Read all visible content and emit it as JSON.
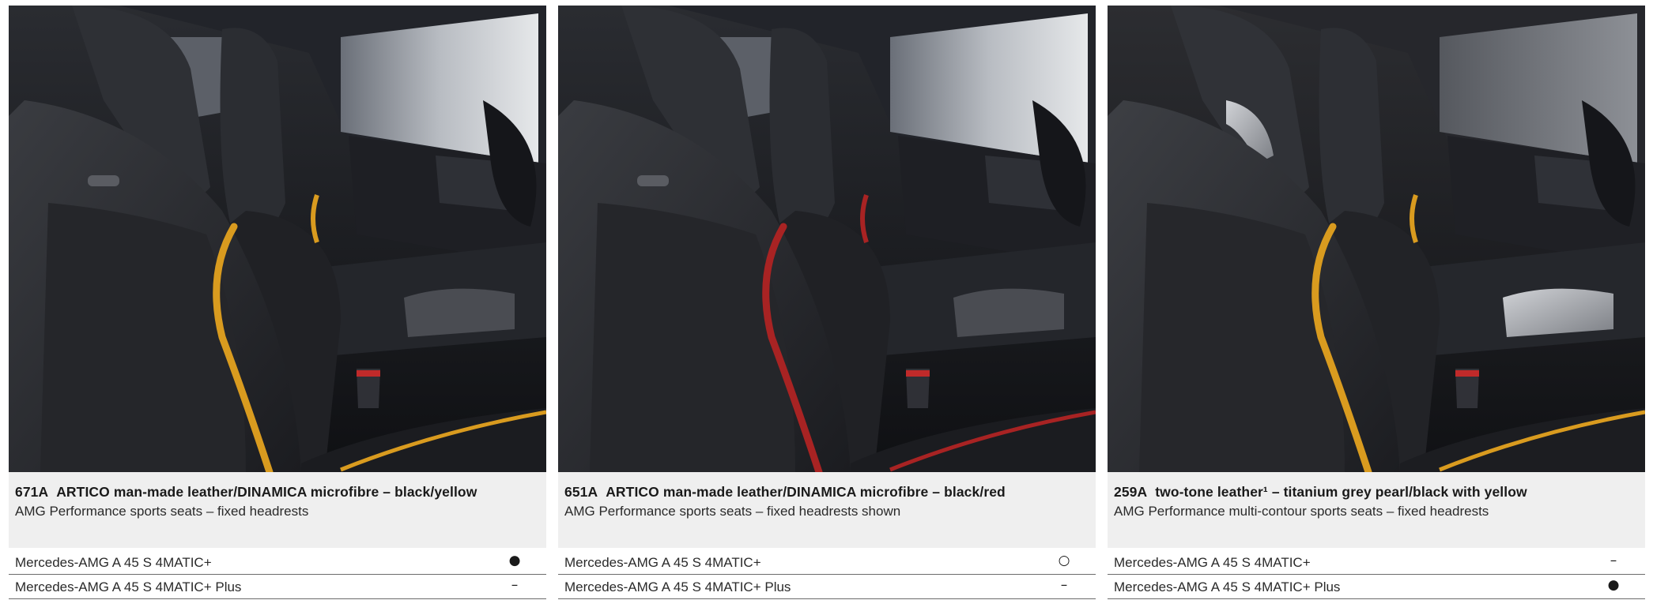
{
  "cards": [
    {
      "code": "671A",
      "title": "ARTICO man-made leather/DINAMICA microfibre – black/yellow",
      "subtitle": "AMG Performance sports seats – fixed headrests",
      "accent_color": "#d99b1f",
      "rows": [
        {
          "model": "Mercedes-AMG A 45 S 4MATIC+",
          "availability": "●"
        },
        {
          "model": "Mercedes-AMG A 45 S 4MATIC+ Plus",
          "availability": "–"
        }
      ]
    },
    {
      "code": "651A",
      "title": "ARTICO man-made leather/DINAMICA microfibre – black/red",
      "subtitle": "AMG Performance sports seats – fixed headrests shown",
      "accent_color": "#a82323",
      "rows": [
        {
          "model": "Mercedes-AMG A 45 S 4MATIC+",
          "availability": "○"
        },
        {
          "model": "Mercedes-AMG A 45 S 4MATIC+ Plus",
          "availability": "–"
        }
      ]
    },
    {
      "code": "259A",
      "title": "two-tone leather¹ – titanium grey pearl/black with yellow",
      "subtitle": "AMG Performance multi-contour sports seats – fixed headrests",
      "accent_color": "#d99b1f",
      "rows": [
        {
          "model": "Mercedes-AMG A 45 S 4MATIC+",
          "availability": "–"
        },
        {
          "model": "Mercedes-AMG A 45 S 4MATIC+ Plus",
          "availability": "●"
        }
      ]
    }
  ]
}
